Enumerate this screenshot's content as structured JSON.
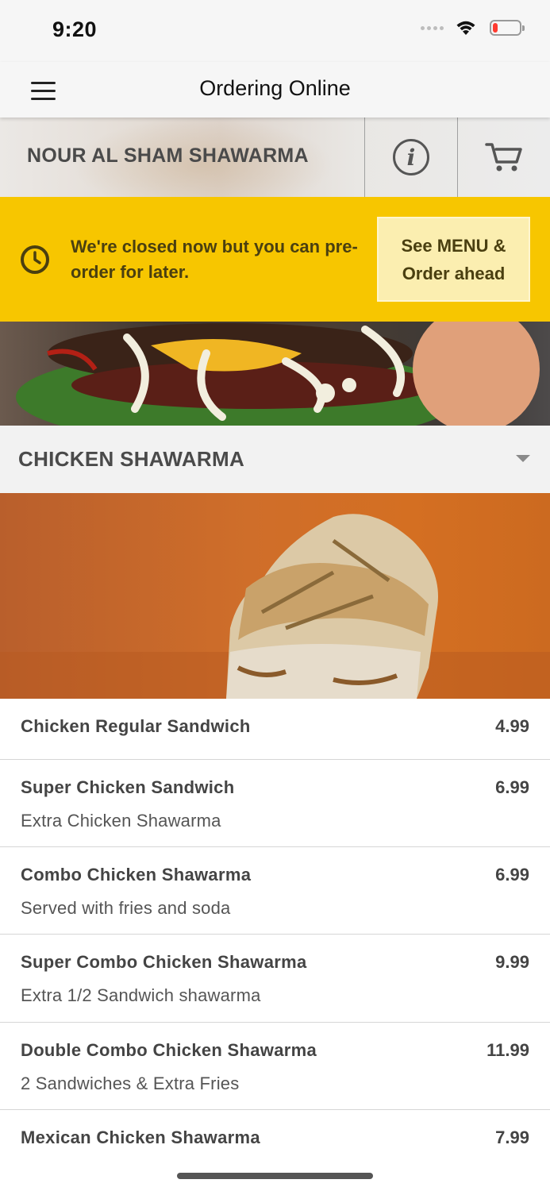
{
  "status_bar": {
    "time": "9:20",
    "icons": [
      "signal-dots-icon",
      "wifi-icon",
      "battery-icon"
    ],
    "battery_level": 0.2,
    "battery_color": "#ff3b30"
  },
  "nav": {
    "title": "Ordering Online",
    "menu_icon": "hamburger-menu-icon"
  },
  "restaurant": {
    "name": "NOUR AL SHAM SHAWARMA",
    "info_icon": "info-icon",
    "cart_icon": "cart-icon"
  },
  "closed_banner": {
    "message": "We're closed now but you can pre-order for later.",
    "button_label": "See MENU & Order ahead",
    "icon": "clock-icon",
    "background_color": "#f7c600"
  },
  "category": {
    "title": "CHICKEN SHAWARMA",
    "toggle_icon": "chevron-down-icon"
  },
  "menu_items": [
    {
      "name": "Chicken Regular Sandwich",
      "price": "4.99",
      "description": ""
    },
    {
      "name": "Super Chicken Sandwich",
      "price": "6.99",
      "description": "Extra Chicken Shawarma"
    },
    {
      "name": "Combo Chicken Shawarma",
      "price": "6.99",
      "description": "Served with fries and soda"
    },
    {
      "name": "Super Combo Chicken Shawarma",
      "price": "9.99",
      "description": "Extra 1/2 Sandwich shawarma"
    },
    {
      "name": "Double Combo Chicken Shawarma",
      "price": "11.99",
      "description": "2 Sandwiches & Extra Fries"
    },
    {
      "name": "Mexican Chicken Shawarma",
      "price": "7.99",
      "description": ""
    }
  ]
}
